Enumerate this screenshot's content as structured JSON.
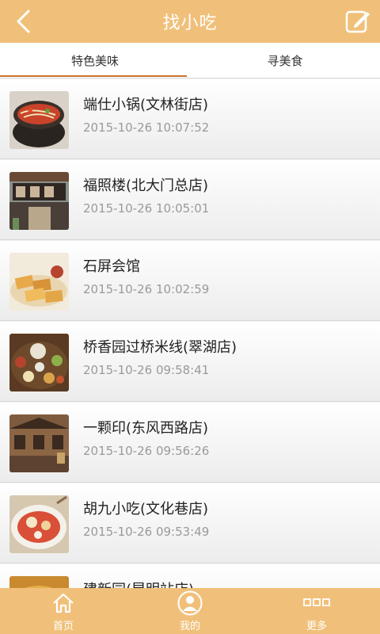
{
  "header": {
    "title": "找小吃"
  },
  "tabs": [
    {
      "label": "特色美味"
    },
    {
      "label": "寻美食"
    }
  ],
  "colors": {
    "bar": "#f0c07a",
    "accent": "#c8722e"
  },
  "items": [
    {
      "name": "端仕小锅(文林街店)",
      "time": "2015-10-26 10:07:52",
      "thumb": "noodle-pot-photo"
    },
    {
      "name": "福照楼(北大门总店)",
      "time": "2015-10-26 10:05:01",
      "thumb": "storefront-photo"
    },
    {
      "name": "石屏会馆",
      "time": "2015-10-26 10:02:59",
      "thumb": "tofu-photo"
    },
    {
      "name": "桥香园过桥米线(翠湖店)",
      "time": "2015-10-26 09:58:41",
      "thumb": "rice-noodle-set-photo"
    },
    {
      "name": "一颗印(东风西路店)",
      "time": "2015-10-26 09:56:26",
      "thumb": "courtyard-photo"
    },
    {
      "name": "胡九小吃(文化巷店)",
      "time": "2015-10-26 09:53:49",
      "thumb": "dessert-bowl-photo"
    },
    {
      "name": "建新园(昆明站店)",
      "time": "",
      "thumb": "noodle-photo"
    }
  ],
  "bottom_nav": [
    {
      "label": "首页",
      "icon": "home-icon"
    },
    {
      "label": "我的",
      "icon": "user-icon"
    },
    {
      "label": "更多",
      "icon": "more-icon"
    }
  ]
}
